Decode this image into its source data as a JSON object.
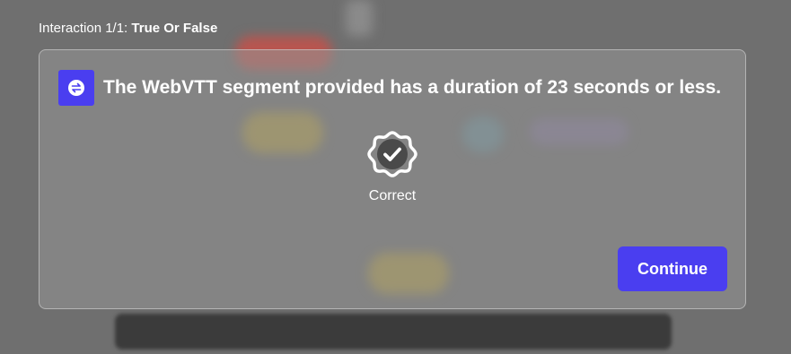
{
  "header": {
    "prefix": "Interaction 1/1: ",
    "interaction_type": "True Or False"
  },
  "question": {
    "icon": "swap-arrows-icon",
    "text": "The WebVTT segment provided has a duration of 23 seconds or less."
  },
  "result": {
    "icon": "check-badge-icon",
    "label": "Correct"
  },
  "actions": {
    "continue_label": "Continue"
  },
  "colors": {
    "accent": "#4a3ef0",
    "text": "#ffffff"
  }
}
